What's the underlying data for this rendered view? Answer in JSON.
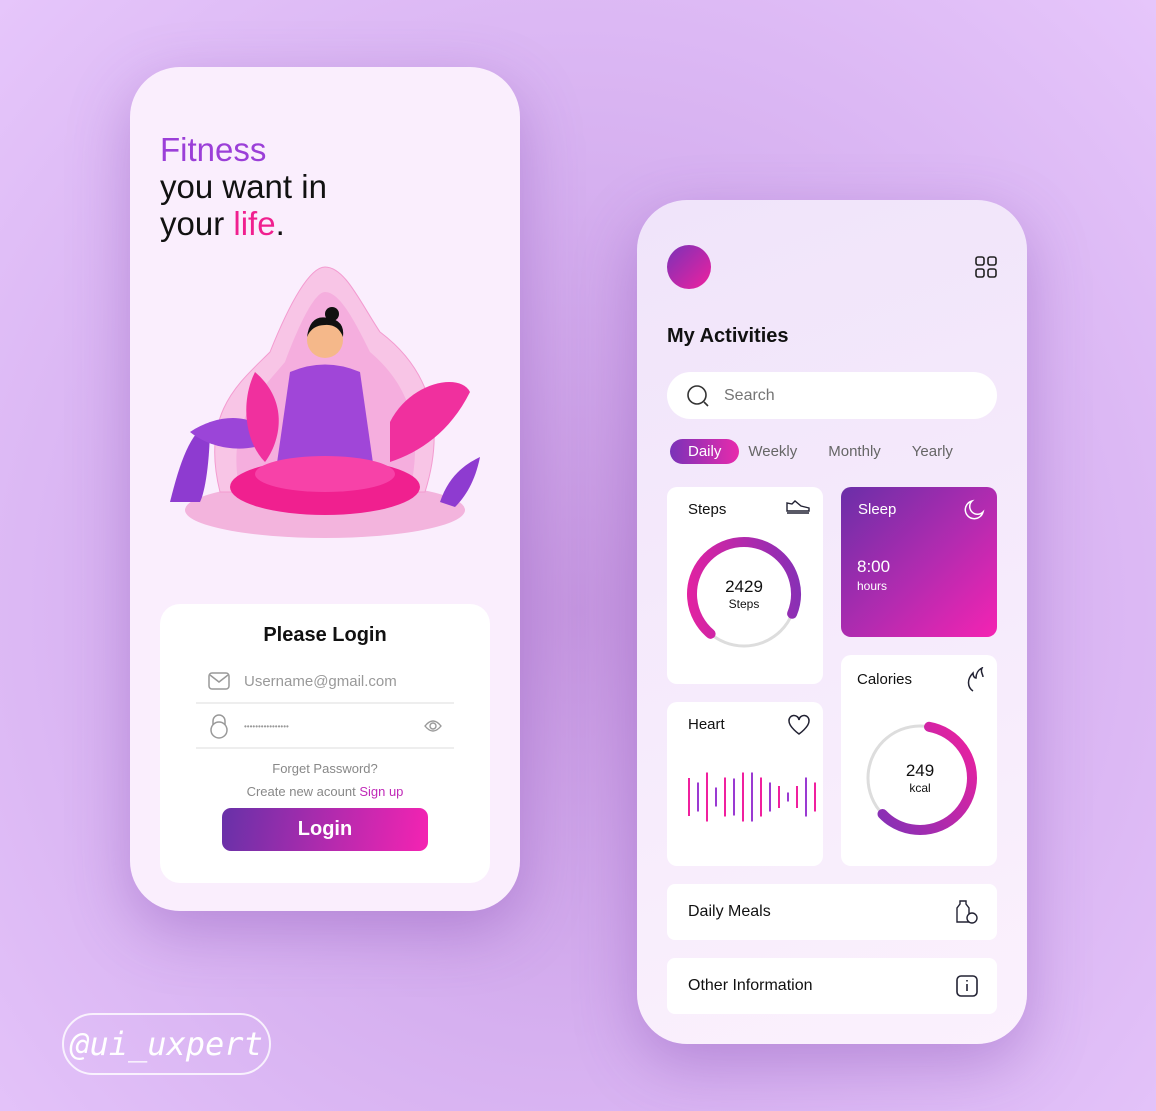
{
  "login": {
    "hero": {
      "line1": "Fitness",
      "line2": "you want in",
      "line3a": "your ",
      "line3b": "life",
      "line3c": "."
    },
    "card_title": "Please Login",
    "username_placeholder": "Username@gmail.com",
    "password_value": "••••••••••••••••",
    "forgot": "Forget Password?",
    "create_text": "Create new acount ",
    "signup": "Sign up",
    "login_button": "Login"
  },
  "dashboard": {
    "title": "My Activities",
    "search_placeholder": "Search",
    "tabs": [
      {
        "label": "Daily",
        "active": true
      },
      {
        "label": "Weekly"
      },
      {
        "label": "Monthly"
      },
      {
        "label": "Yearly"
      }
    ],
    "steps": {
      "label": "Steps",
      "value": "2429",
      "unit": "Steps",
      "progress": 0.7,
      "icon": "sneaker-icon"
    },
    "sleep": {
      "label": "Sleep",
      "value": "8:00",
      "unit": "hours",
      "icon": "moon-icon"
    },
    "heart": {
      "label": "Heart",
      "icon": "heart-icon",
      "bars": [
        38,
        29,
        49,
        19,
        39,
        37,
        49,
        49,
        39,
        29,
        22,
        9,
        22,
        39,
        29
      ]
    },
    "calories": {
      "label": "Calories",
      "value": "249",
      "unit": "kcal",
      "progress": 0.6,
      "icon": "flame-icon"
    },
    "rows": [
      {
        "label": "Daily Meals",
        "icon": "meal-icon"
      },
      {
        "label": "Other Information",
        "icon": "info-icon"
      }
    ]
  },
  "colors": {
    "purple": "#7a32b8",
    "pink": "#f0209e"
  },
  "watermark": "@ui_uxpert"
}
